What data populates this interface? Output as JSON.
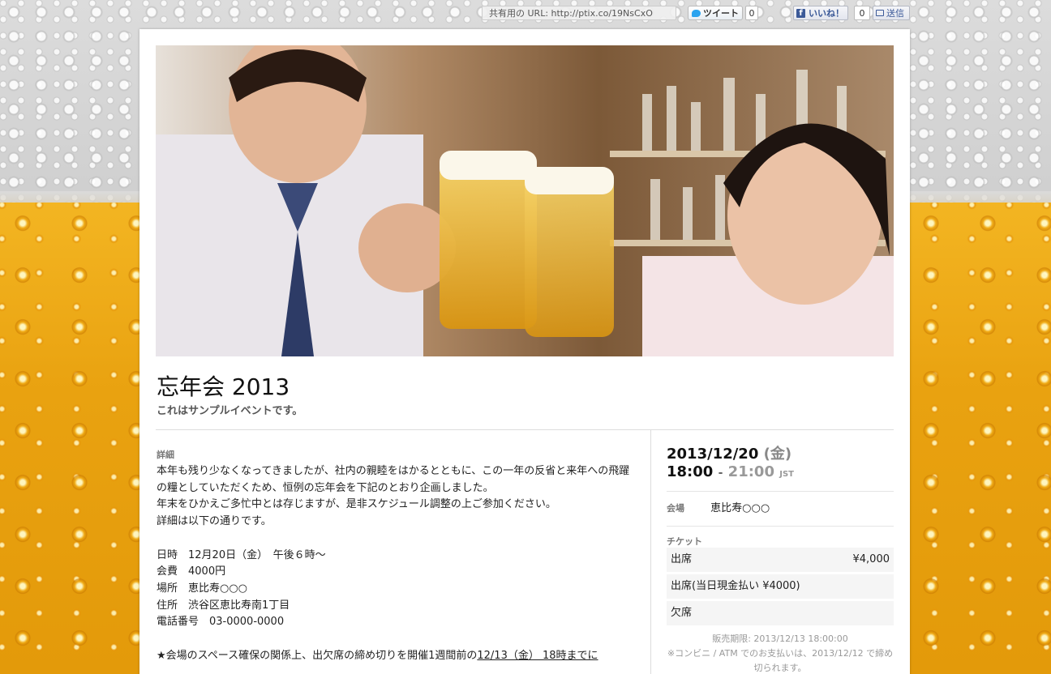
{
  "share": {
    "url_label": "共有用の URL: http://ptix.co/19NsCxO",
    "tweet_label": "ツイート",
    "tweet_count": "0",
    "like_label": "いいね！",
    "like_count": "0",
    "send_label": "送信"
  },
  "event": {
    "title": "忘年会 2013",
    "subtitle": "これはサンプルイベントです。"
  },
  "details": {
    "label": "詳細",
    "paragraph1": "本年も残り少なくなってきましたが、社内の親睦をはかるとともに、この一年の反省と来年への飛躍の糧としていただくため、恒例の忘年会を下記のとおり企画しました。",
    "paragraph2": "年末をひかえご多忙中とは存じますが、是非スケジュール調整の上ご参加ください。",
    "paragraph3": "詳細は以下の通りです。",
    "info": [
      "日時　12月20日（金）　午後６時～",
      "会費　4000円",
      "場所　恵比寿○○○",
      "住所　渋谷区恵比寿南1丁目",
      "電話番号　03-0000-0000"
    ],
    "notice_prefix": "★会場のスペース確保の関係上、出欠席の締め切りを開催1週間前の",
    "notice_underlined": "12/13（金） 18時までに"
  },
  "schedule": {
    "date": "2013/12/20",
    "dow": "(金)",
    "start": "18:00",
    "sep": "-",
    "end": "21:00",
    "tz": "JST"
  },
  "venue": {
    "label": "会場",
    "name": "恵比寿○○○"
  },
  "tickets": {
    "label": "チケット",
    "items": [
      {
        "name": "出席",
        "price": "¥4,000"
      },
      {
        "name": "出席(当日現金払い ¥4000)",
        "price": ""
      },
      {
        "name": "欠席",
        "price": ""
      }
    ],
    "sale_deadline": "販売期限: 2013/12/13 18:00:00",
    "convenience_note": "※コンビニ / ATM でのお支払いは、2013/12/12 で締め切られます。"
  },
  "colors": {
    "beer": "#e9a210",
    "foam": "#dcdcdc",
    "twitter": "#2aa3ef",
    "facebook": "#3b5998"
  }
}
